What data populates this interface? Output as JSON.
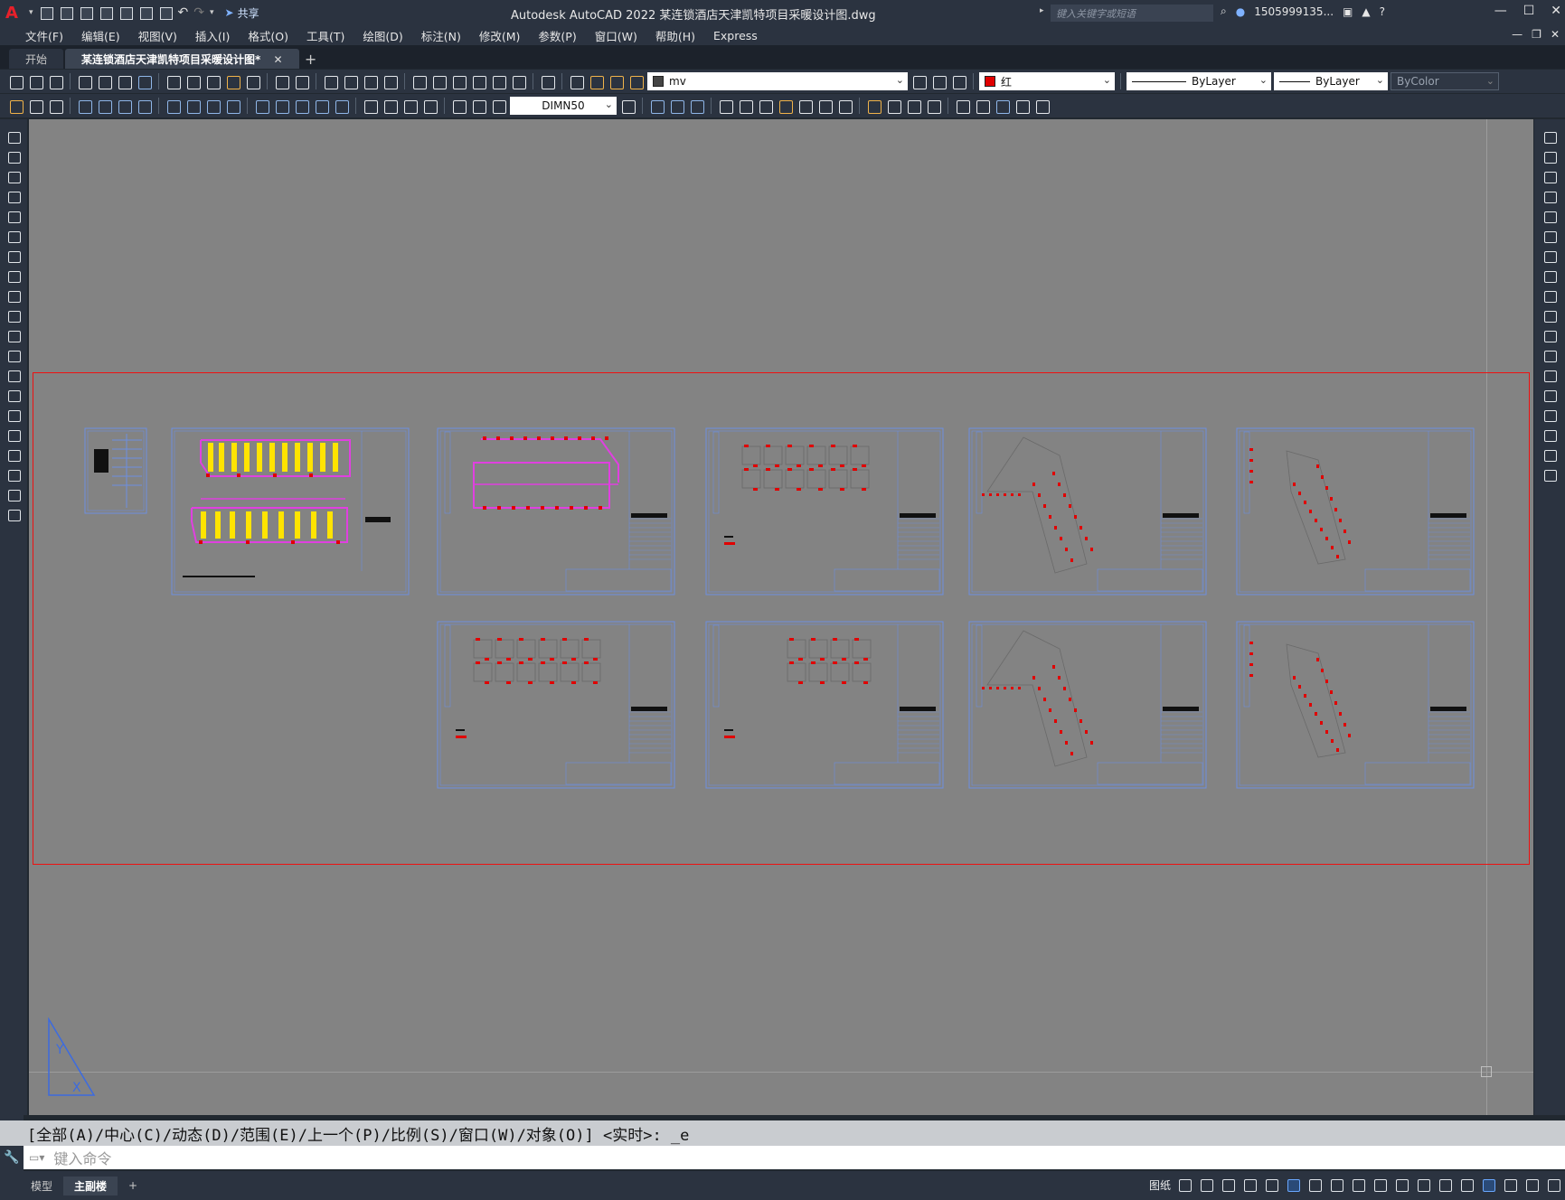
{
  "titlebar": {
    "app_letter": "A",
    "share_label": "共享",
    "title": "Autodesk AutoCAD 2022    某连锁酒店天津凯特项目采暖设计图.dwg",
    "search_placeholder": "键入关键字或短语",
    "user": "1505999135...",
    "help": "?"
  },
  "menubar": {
    "items": [
      "文件(F)",
      "编辑(E)",
      "视图(V)",
      "插入(I)",
      "格式(O)",
      "工具(T)",
      "绘图(D)",
      "标注(N)",
      "修改(M)",
      "参数(P)",
      "窗口(W)",
      "帮助(H)",
      "Express"
    ]
  },
  "tabs": {
    "start": "开始",
    "document": "某连锁酒店天津凯特项目采暖设计图*",
    "close": "✕",
    "add": "+"
  },
  "properties": {
    "layer": "mv",
    "color": "红",
    "color_hex": "#e00000",
    "linetype": "ByLayer",
    "lineweight": "ByLayer",
    "plotstyle": "ByColor"
  },
  "styles": {
    "dimstyle": "DIMN50"
  },
  "command": {
    "history": "[全部(A)/中心(C)/动态(D)/范围(E)/上一个(P)/比例(S)/窗口(W)/对象(O)] <实时>: _e",
    "input_placeholder": "键入命令"
  },
  "status": {
    "model_tab": "模型",
    "layout_tab": "主副楼",
    "add": "+",
    "paper": "图纸"
  }
}
